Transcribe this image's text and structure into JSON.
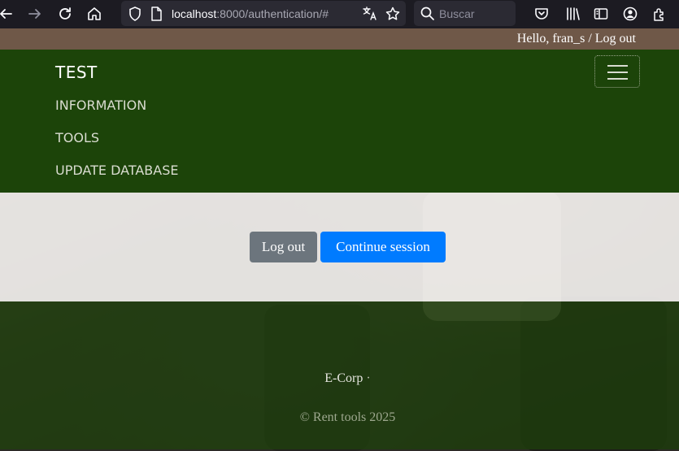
{
  "browser": {
    "url_host": "localhost",
    "url_rest": ":8000/authentication/#",
    "search_placeholder": "Buscar"
  },
  "header": {
    "greeting": "Hello, fran_s / Log out"
  },
  "navbar": {
    "brand": "TEST",
    "links": [
      "INFORMATION",
      "TOOLS",
      "UPDATE DATABASE"
    ]
  },
  "auth": {
    "logout_label": "Log out",
    "continue_label": "Continue session"
  },
  "footer": {
    "company": "E-Corp",
    "separator": "·",
    "copyright": "© Rent tools 2025"
  },
  "colors": {
    "navbar": "#1c4409",
    "top_strip": "#6f5848",
    "btn_secondary": "#6c757d",
    "btn_primary": "#007bff"
  }
}
